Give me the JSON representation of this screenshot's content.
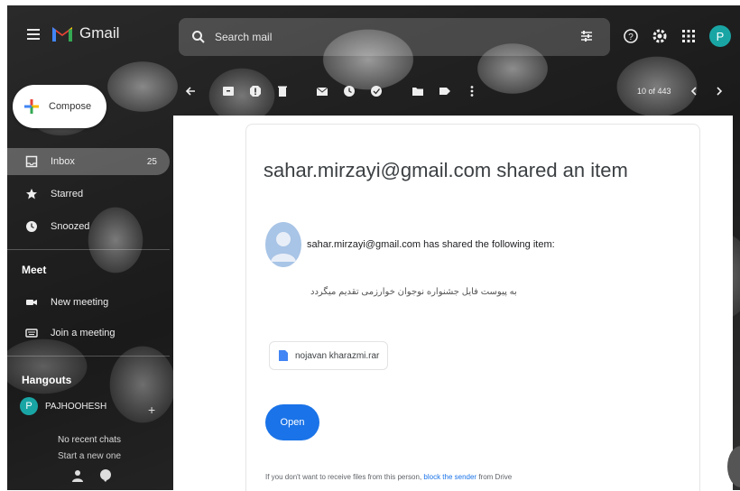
{
  "header": {
    "app_name": "Gmail",
    "search_placeholder": "Search mail",
    "avatar_letter": "P"
  },
  "sidebar": {
    "compose_label": "Compose",
    "items": [
      {
        "label": "Inbox",
        "count": "25",
        "icon": "inbox-icon"
      },
      {
        "label": "Starred",
        "icon": "star-icon"
      },
      {
        "label": "Snoozed",
        "icon": "clock-icon"
      }
    ],
    "meet_title": "Meet",
    "meet_items": [
      {
        "label": "New meeting",
        "icon": "video-icon"
      },
      {
        "label": "Join a meeting",
        "icon": "keyboard-icon"
      }
    ],
    "hangouts_title": "Hangouts",
    "hangouts_user": "PAJHOOHESH",
    "hangouts_avatar": "P",
    "no_recent_chats": "No recent chats",
    "start_new_chat": "Start a new one"
  },
  "toolbar": {
    "page_count": "10 of 443"
  },
  "message": {
    "subject": "sahar.mirzayi@gmail.com shared an item",
    "shared_line": "sahar.mirzayi@gmail.com has shared the following item:",
    "body_text": "به پیوست فایل جشنواره نوجوان خوارزمی تقدیم میگردد",
    "file_name": "nojavan kharazmi.rar",
    "open_label": "Open",
    "footer_prefix": "If you don't want to receive files from this person, ",
    "footer_link": "block the sender",
    "footer_suffix": " from Drive"
  },
  "colors": {
    "accent": "#1a73e8",
    "avatar": "#1aa5a5"
  }
}
